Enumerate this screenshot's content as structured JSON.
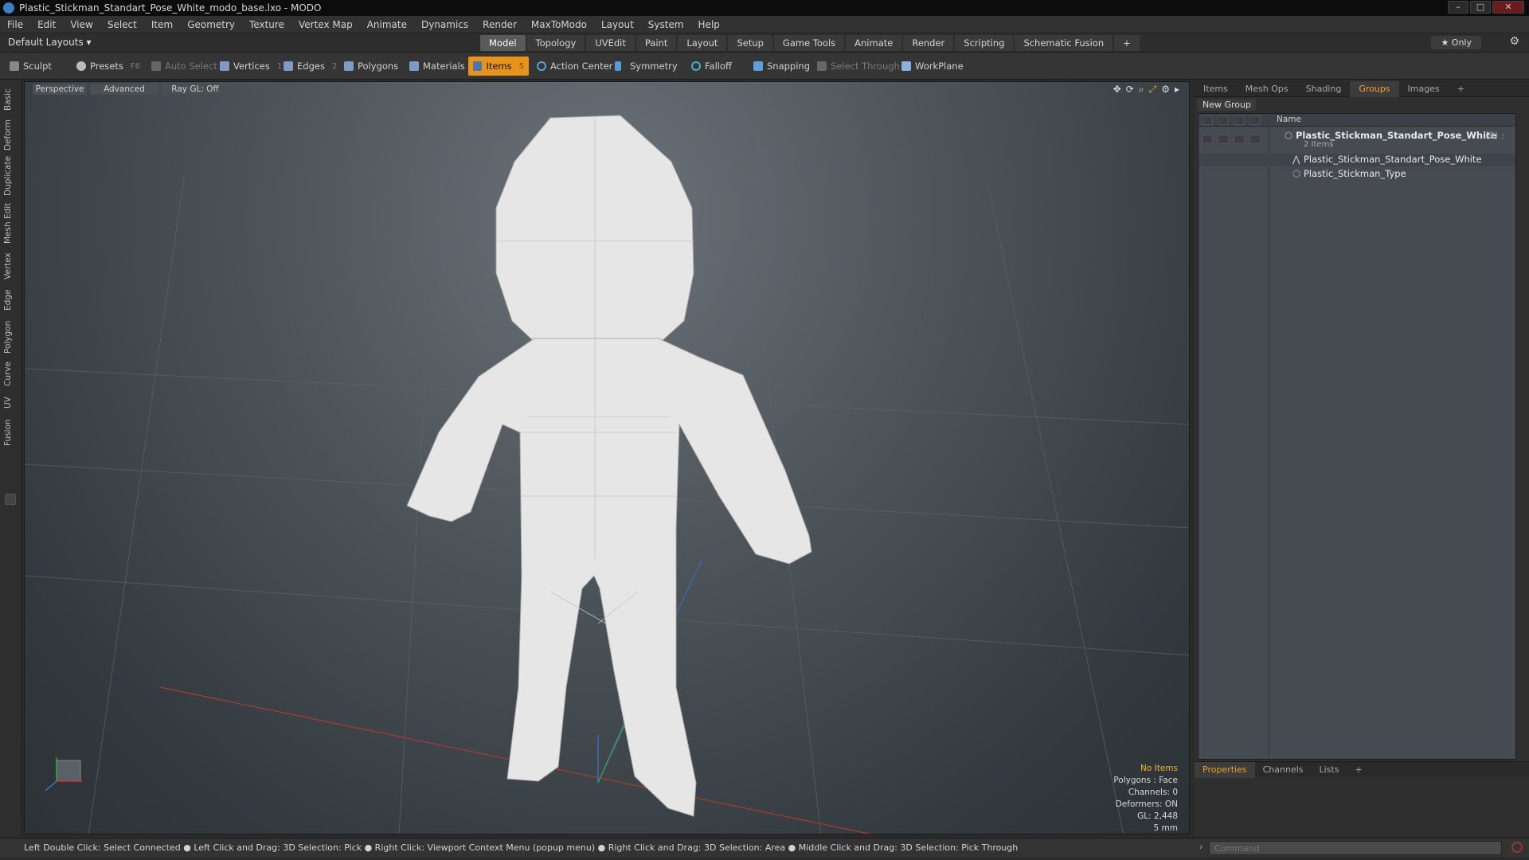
{
  "window": {
    "title": "Plastic_Stickman_Standart_Pose_White_modo_base.lxo - MODO",
    "min": "–",
    "max": "□",
    "close": "✕"
  },
  "menu": [
    "File",
    "Edit",
    "View",
    "Select",
    "Item",
    "Geometry",
    "Texture",
    "Vertex Map",
    "Animate",
    "Dynamics",
    "Render",
    "MaxToModo",
    "Layout",
    "System",
    "Help"
  ],
  "layouts_label": "Default Layouts ▾",
  "layout_tabs": [
    {
      "label": "Model",
      "active": true
    },
    {
      "label": "Topology"
    },
    {
      "label": "UVEdit"
    },
    {
      "label": "Paint"
    },
    {
      "label": "Layout"
    },
    {
      "label": "Setup"
    },
    {
      "label": "Game Tools"
    },
    {
      "label": "Animate"
    },
    {
      "label": "Render"
    },
    {
      "label": "Scripting"
    },
    {
      "label": "Schematic Fusion"
    },
    {
      "label": "+"
    }
  ],
  "only_label": "★ Only",
  "toolbar": {
    "sculpt": "Sculpt",
    "presets": "Presets",
    "presets_key": "F6",
    "auto_select": "Auto Select",
    "vertices": "Vertices",
    "vertices_key": "1",
    "edges": "Edges",
    "edges_key": "2",
    "polygons": "Polygons",
    "materials": "Materials",
    "items": "Items",
    "items_key": "5",
    "action_center": "Action Center",
    "symmetry": "Symmetry",
    "falloff": "Falloff",
    "snapping": "Snapping",
    "select_through": "Select Through",
    "workplane": "WorkPlane"
  },
  "left_tabs": [
    "Basic",
    "Deform",
    "Duplicate",
    "Mesh Edit",
    "Vertex",
    "Edge",
    "Polygon",
    "Curve",
    "UV",
    "Fusion"
  ],
  "viewport": {
    "view": "Perspective",
    "mode": "Advanced",
    "raygl": "Ray GL: Off"
  },
  "info": {
    "items": "No Items",
    "polygons": "Polygons : Face",
    "channels": "Channels: 0",
    "deformers": "Deformers: ON",
    "gl": "GL: 2,448",
    "scale": "5 mm"
  },
  "right_tabs": [
    "Items",
    "Mesh Ops",
    "Shading",
    "Groups",
    "Images",
    "+"
  ],
  "new_group": "New Group",
  "tree": {
    "col_name": "Name",
    "group": "Plastic_Stickman_Standart_Pose_White",
    "group_count": "(2) :",
    "group_sub": "2 Items",
    "child1": "Plastic_Stickman_Standart_Pose_White",
    "child2": "Plastic_Stickman_Type"
  },
  "bottom_tabs": [
    "Properties",
    "Channels",
    "Lists",
    "+"
  ],
  "status": "Left Double Click: Select Connected ● Left Click and Drag: 3D Selection: Pick ● Right Click: Viewport Context Menu (popup menu) ● Right Click and Drag: 3D Selection: Area ● Middle Click and Drag: 3D Selection: Pick Through",
  "command_placeholder": "Command",
  "colors": {
    "accent": "#e8931a",
    "tab_active": "#f0a030"
  }
}
